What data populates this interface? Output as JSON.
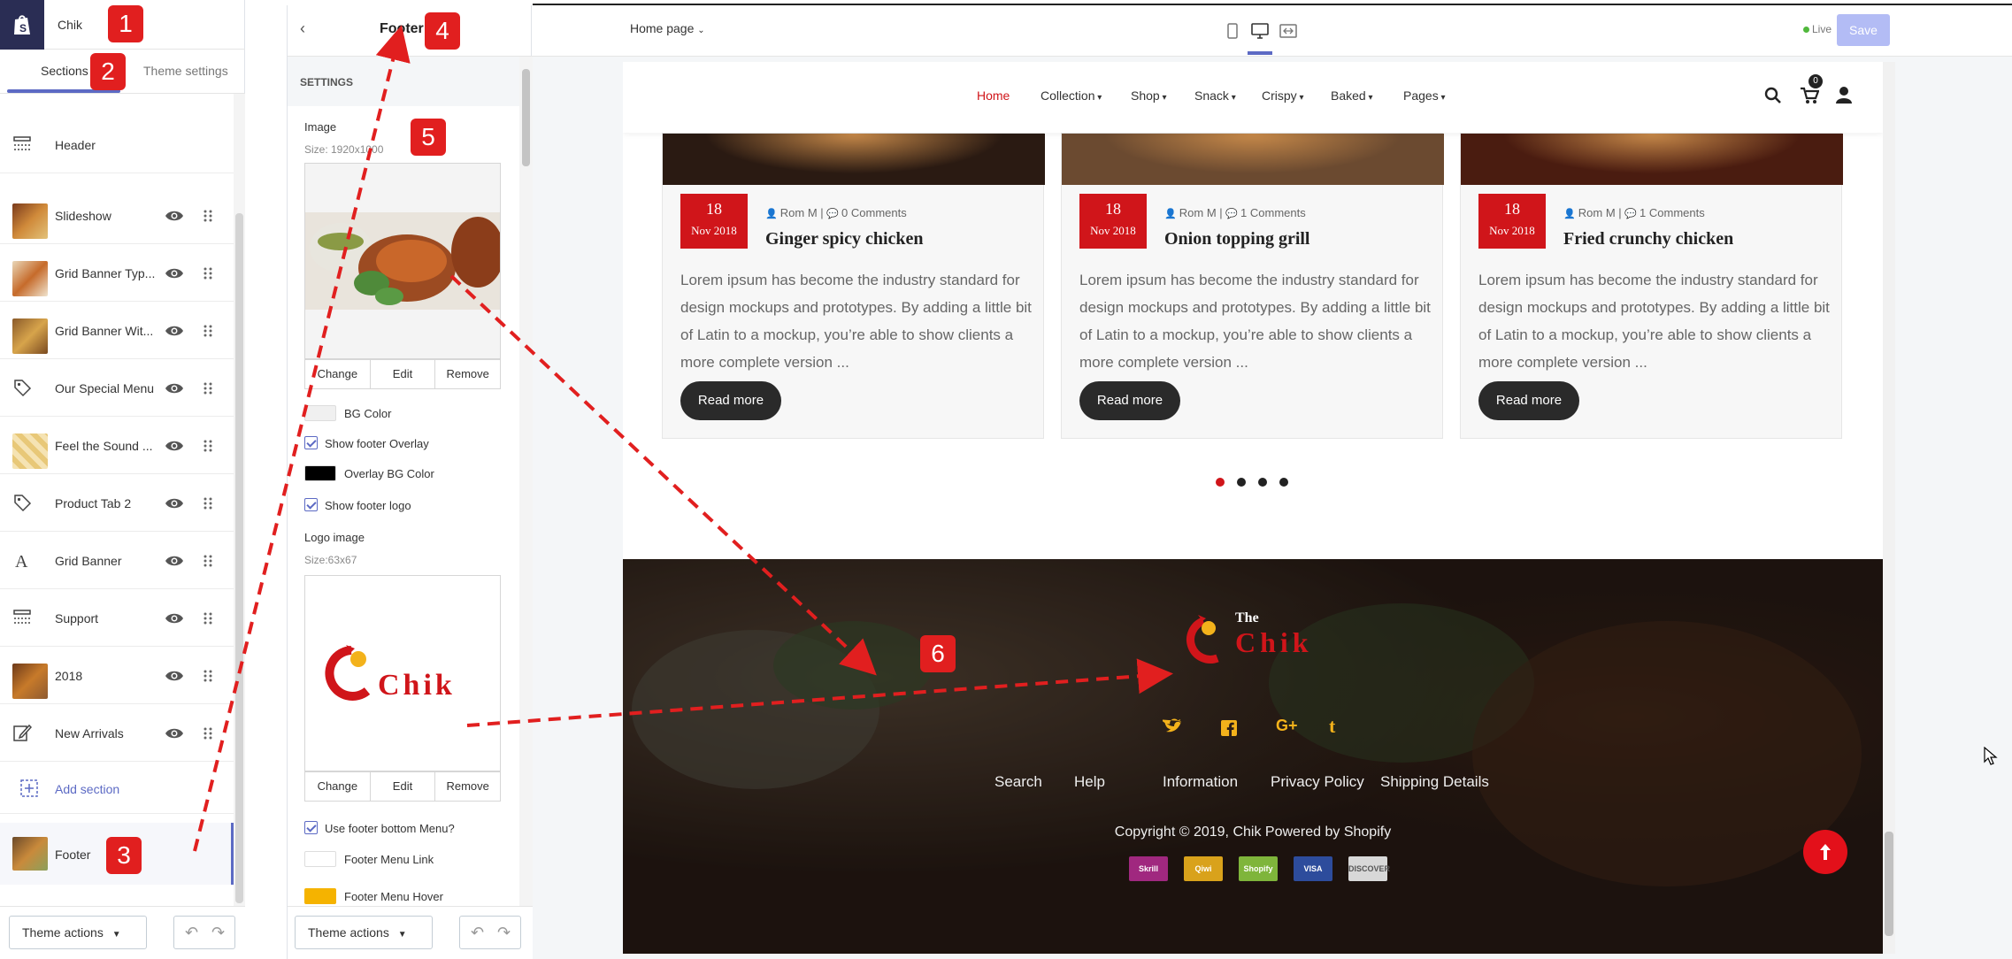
{
  "store_name": "Chik",
  "tabs": {
    "sections": "Sections",
    "theme_settings": "Theme settings"
  },
  "sections": [
    {
      "label": "Header",
      "icon": "header-icon"
    },
    {
      "label": "Slideshow",
      "icon": "image-thumb"
    },
    {
      "label": "Grid Banner Typ...",
      "icon": "image-thumb"
    },
    {
      "label": "Grid Banner Wit...",
      "icon": "image-thumb"
    },
    {
      "label": "Our Special Menu",
      "icon": "tag-icon"
    },
    {
      "label": "Feel the Sound ...",
      "icon": "image-thumb"
    },
    {
      "label": "Product Tab 2",
      "icon": "tag-icon"
    },
    {
      "label": "Grid Banner",
      "icon": "text-icon"
    },
    {
      "label": "Support",
      "icon": "header-icon"
    },
    {
      "label": "2018",
      "icon": "image-thumb"
    },
    {
      "label": "New Arrivals",
      "icon": "edit-icon"
    }
  ],
  "add_section": "Add section",
  "footer_section": "Footer",
  "theme_actions": "Theme actions",
  "settings": {
    "title": "Footer",
    "group": "SETTINGS",
    "image_label": "Image",
    "image_size": "Size: 1920x1000",
    "change": "Change",
    "edit": "Edit",
    "remove": "Remove",
    "bg_color": "BG Color",
    "show_overlay": "Show footer Overlay",
    "overlay_bg": "Overlay BG Color",
    "show_logo": "Show footer logo",
    "logo_label": "Logo image",
    "logo_size": "Size:63x67",
    "use_bottom_menu": "Use footer bottom Menu?",
    "menu_link": "Footer Menu Link",
    "menu_hover": "Footer Menu Hover",
    "colors": {
      "bg": "#f0f0f0",
      "overlay": "#000000",
      "menu_link": "#ffffff",
      "menu_hover": "#f5b300"
    }
  },
  "topbar": {
    "page_select": "Home page",
    "live": "Live",
    "save": "Save"
  },
  "nav": [
    "Home",
    "Collection",
    "Shop",
    "Snack",
    "Crispy",
    "Baked",
    "Pages"
  ],
  "cart_count": "0",
  "posts": [
    {
      "day": "18",
      "month": "Nov 2018",
      "author": "Rom M",
      "comments": "0 Comments",
      "title": "Ginger spicy chicken"
    },
    {
      "day": "18",
      "month": "Nov 2018",
      "author": "Rom M",
      "comments": "1 Comments",
      "title": "Onion topping grill"
    },
    {
      "day": "18",
      "month": "Nov 2018",
      "author": "Rom M",
      "comments": "1 Comments",
      "title": "Fried crunchy chicken"
    }
  ],
  "post_body": "Lorem ipsum has become the industry standard for design mockups and prototypes. By adding a little bit of Latin to a mockup, you’re able to show clients a more complete version ...",
  "read_more": "Read more",
  "footer": {
    "logo_small": "The",
    "logo_big": "Chik",
    "links": [
      "Search",
      "Help",
      "Information",
      "Privacy Policy",
      "Shipping Details"
    ],
    "copyright": "Copyright © 2019, Chik Powered by Shopify",
    "payments": [
      "Skrill",
      "Qiwi",
      "Shopify",
      "VISA",
      "DISCOVER"
    ]
  },
  "annotations": [
    "1",
    "2",
    "3",
    "4",
    "5",
    "6"
  ],
  "accent": "#d0151a",
  "admin_accent": "#5c6ac4"
}
